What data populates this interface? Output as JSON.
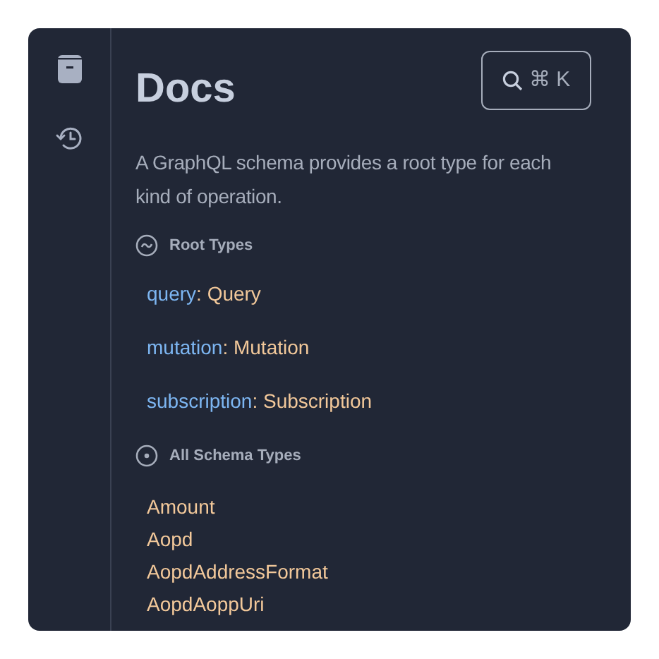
{
  "title": "Docs",
  "search_button": {
    "icon_label": "⌘ K"
  },
  "description": "A GraphQL schema provides a root type for each kind of operation.",
  "root_types": {
    "heading": "Root Types",
    "fields": [
      {
        "name": "query",
        "separator": ":",
        "type": "Query"
      },
      {
        "name": "mutation",
        "separator": ":",
        "type": "Mutation"
      },
      {
        "name": "subscription",
        "separator": ":",
        "type": "Subscription"
      }
    ]
  },
  "all_types": {
    "heading": "All Schema Types",
    "types": [
      "Amount",
      "Aopd",
      "AopdAddressFormat",
      "AopdAoppUri"
    ]
  }
}
